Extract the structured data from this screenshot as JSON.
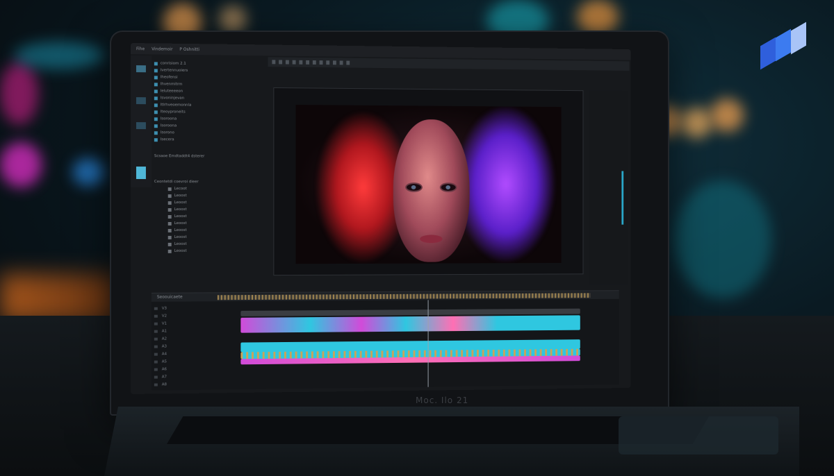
{
  "brand": {
    "laptop_text": "Moc. Ilo 21",
    "logo_colors": [
      "#2f5fdc",
      "#3c7bf0",
      "#a9c4f7"
    ]
  },
  "menubar": {
    "items": [
      "Fihe",
      "Vindemoir",
      "P Oshnitti"
    ]
  },
  "project_panel": {
    "items": [
      "conrisiom 2.1",
      "Ivertennuoiers",
      "Iheofensi",
      "Ihvenmitrm",
      "Ieluteeeeon",
      "Isvoninjevan",
      "Itlrhveoemonnla",
      "Iteoyproneits",
      "Isoroona",
      "Isoroona",
      "Isorono",
      "Isecera"
    ],
    "footer": "Scsaoe Emdtaddt4 dsterer"
  },
  "effects_panel": {
    "title": "Ceontetdi coevroi dieer",
    "items": [
      "Lecoot",
      "Leoost",
      "Leoost",
      "Leoost",
      "Leoost",
      "Leoost",
      "Leoost",
      "Leoost",
      "Leoost",
      "Leoost"
    ]
  },
  "timeline": {
    "title": "Seoouicaete",
    "track_names": [
      "V3",
      "V2",
      "V1",
      "A1",
      "A2",
      "A3",
      "A4",
      "A5",
      "A6",
      "A7",
      "A8"
    ],
    "colors": {
      "magenta": "#d14bd9",
      "cyan": "#2fc7e0",
      "pink": "#ff6fb4",
      "gold": "#c8a45a"
    }
  },
  "viewer": {
    "alt": "Portrait of a woman lit with red and purple light"
  }
}
